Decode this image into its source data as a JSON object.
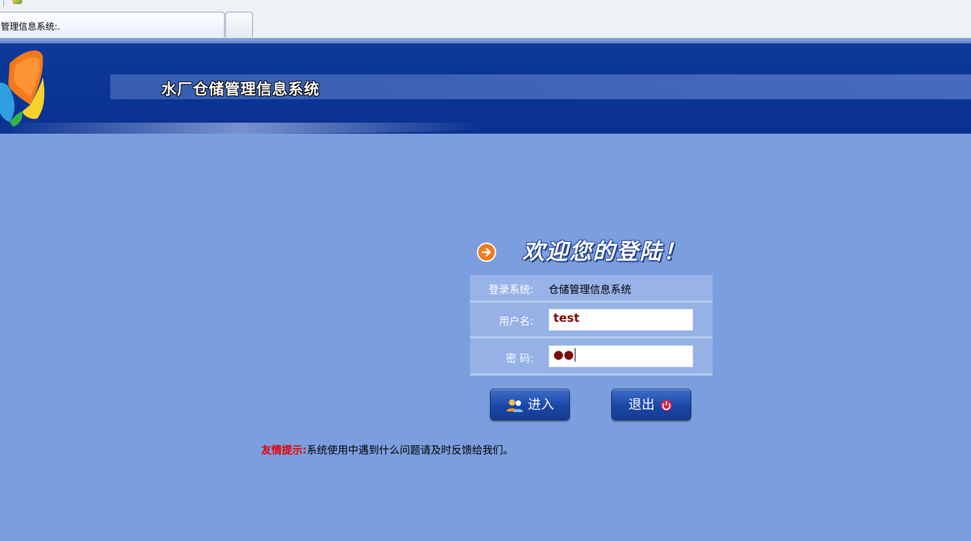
{
  "browser": {
    "tab_title": "管理信息系统:."
  },
  "header": {
    "system_title": "水厂仓储管理信息系统"
  },
  "login": {
    "welcome": "欢迎您的登陆！",
    "system_label": "登录系统:",
    "system_value": "仓储管理信息系统",
    "username_label": "用户名:",
    "username_value": "test",
    "password_label": "密  码:",
    "password_masked": "●●",
    "enter_button": "进入",
    "exit_button": "退出"
  },
  "hint": {
    "label": "友情提示:",
    "text": "系统使用中遇到什么问题请及时反馈给我们。"
  },
  "colors": {
    "page_background": "#7b9ede",
    "header_background": "#0a3495",
    "hint_label": "#e80000",
    "input_text": "#7b0b0b"
  }
}
